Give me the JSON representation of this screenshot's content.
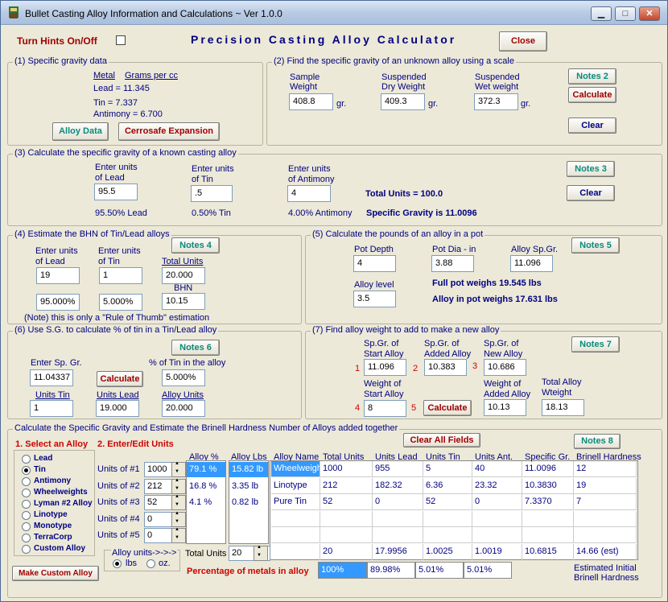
{
  "window": {
    "title": "Bullet Casting Alloy Information and Calculations ~ Ver 1.0.0",
    "minimize": "▁",
    "maximize": "□",
    "close": "✕"
  },
  "top": {
    "hints_label": "Turn Hints On/Off",
    "heading": "Precision Casting Alloy Calculator",
    "close_button": "Close"
  },
  "s1": {
    "title": "(1) Specific gravity data",
    "col_metal": "Metal",
    "col_gpcc": "Grams per cc",
    "lead": "Lead  =  11.345",
    "tin": "Tin  =   7.337",
    "antimony": "Antimony  =  6.700",
    "alloy_data_btn": "Alloy Data",
    "cerrosafe_btn": "Cerrosafe Expansion"
  },
  "s2": {
    "title": "(2) Find the specific gravity of an unknown alloy using a scale",
    "sample_l1": "Sample",
    "sample_l2": "Weight",
    "sample_val": "408.8",
    "dry_l1": "Suspended",
    "dry_l2": "Dry Weight",
    "dry_val": "409.3",
    "wet_l1": "Suspended",
    "wet_l2": "Wet weight",
    "wet_val": "372.3",
    "gr": "gr.",
    "notes_btn": "Notes 2",
    "calc_btn": "Calculate",
    "clear_btn": "Clear"
  },
  "s3": {
    "title": "(3) Calculate the specific gravity of a known casting alloy",
    "lead_l1": "Enter units",
    "lead_l2": "of Lead",
    "lead_val": "95.5",
    "tin_l1": "Enter units",
    "tin_l2": "of Tin",
    "tin_val": ".5",
    "ant_l1": "Enter units",
    "ant_l2": "of Antimony",
    "ant_val": "4",
    "total_units": "Total Units = 100.0",
    "pct_lead": "95.50% Lead",
    "pct_tin": "0.50% Tin",
    "pct_ant": "4.00% Antimony",
    "sg_result": "Specific Gravity is 11.0096",
    "notes_btn": "Notes 3",
    "clear_btn": "Clear"
  },
  "s4": {
    "title": "(4) Estimate the BHN of Tin/Lead alloys",
    "lead_l1": "Enter units",
    "lead_l2": "of Lead",
    "lead_val": "19",
    "tin_l1": "Enter units",
    "tin_l2": "of Tin",
    "tin_val": "1",
    "total_label": "Total Units",
    "total_val": "20.000",
    "bhn_label": "BHN",
    "bhn_val": "10.15",
    "pct_lead": "95.000%",
    "pct_tin": "5.000%",
    "note": "(Note) this is only a \"Rule of Thumb\" estimation",
    "notes_btn": "Notes 4"
  },
  "s5": {
    "title": "(5) Calculate the pounds of an alloy in a pot",
    "depth_label": "Pot Depth",
    "depth_val": "4",
    "dia_label": "Pot Dia - in",
    "dia_val": "3.88",
    "sg_label": "Alloy Sp.Gr.",
    "sg_val": "11.096",
    "level_label": "Alloy level",
    "level_val": "3.5",
    "full_pot": "Full pot weighs 19.545 lbs",
    "in_pot": "Alloy in pot weighs 17.631 lbs",
    "notes_btn": "Notes 5"
  },
  "s6": {
    "title": "(6) Use S.G. to calculate % of tin in a Tin/Lead alloy",
    "sg_label": "Enter Sp. Gr.",
    "sg_val": "11.04337",
    "pct_label": "% of Tin in the alloy",
    "pct_val": "5.000%",
    "units_tin_label": "Units Tin",
    "units_tin_val": "1",
    "units_lead_label": "Units Lead",
    "units_lead_val": "19.000",
    "alloy_units_label": "Alloy Units",
    "alloy_units_val": "20.000",
    "calc_btn": "Calculate",
    "notes_btn": "Notes 6"
  },
  "s7": {
    "title": "(7) Find alloy weight to add  to make a new alloy",
    "start_l1": "Sp.Gr. of",
    "start_l2": "Start Alloy",
    "start_val": "11.096",
    "added_l1": "Sp.Gr. of",
    "added_l2": "Added Alloy",
    "added_val": "10.383",
    "new_l1": "Sp.Gr.  of",
    "new_l2": "New Alloy",
    "new_val": "10.686",
    "wstart_l1": "Weight of",
    "wstart_l2": "Start Alloy",
    "wstart_val": "8",
    "wadded_l1": "Weight of",
    "wadded_l2": "Added Alloy",
    "wadded_val": "10.13",
    "total_l1": "Total Alloy",
    "total_l2": "Wteight",
    "total_val": "18.13",
    "n1": "1",
    "n2": "2",
    "n3": "3",
    "n4": "4",
    "n5": "5",
    "calc_btn": "Calculate",
    "notes_btn": "Notes 7"
  },
  "s8": {
    "title": "Calculate  the Specific Gravity and Estimate the Brinell Hardness Number of Alloys added together",
    "select_label": "1. Select an Alloy",
    "enter_label": "2. Enter/Edit Units",
    "clear_all_btn": "Clear All Fields",
    "notes_btn": "Notes 8",
    "alloys": [
      "Lead",
      "Tin",
      "Antimony",
      "Wheelweights",
      "Lyman #2 Alloy",
      "Linotype",
      "Monotype",
      "TerraCorp",
      "Custom Alloy"
    ],
    "units_labels": [
      "Units of #1",
      "Units of #2",
      "Units of #3",
      "Units of #4",
      "Units of #5"
    ],
    "units_vals": [
      "1000",
      "212",
      "52",
      "0",
      "0"
    ],
    "pct_head": "Alloy %",
    "lbs_head": "Alloy Lbs",
    "pcts": [
      "79.1 %",
      "16.8 %",
      "4.1 %",
      "",
      ""
    ],
    "lbs": [
      "15.82 lb",
      "3.35 lb",
      "0.82 lb",
      "",
      ""
    ],
    "table_headers": [
      "Alloy Name",
      "Total Units",
      "Units Lead",
      "Units Tin",
      "Units Ant.",
      "Specific Gr.",
      "Brinell Hardness"
    ],
    "rows": [
      [
        "Wheelweights",
        "1000",
        "955",
        "5",
        "40",
        "11.0096",
        "12"
      ],
      [
        "Linotype",
        "212",
        "182.32",
        "6.36",
        "23.32",
        "10.3830",
        "19"
      ],
      [
        "Pure Tin",
        "52",
        "0",
        "52",
        "0",
        "7.3370",
        "7"
      ],
      [
        "",
        "",
        "",
        "",
        "",
        "",
        ""
      ],
      [
        "",
        "",
        "",
        "",
        "",
        "",
        ""
      ]
    ],
    "totals": [
      "",
      "20",
      "17.9956",
      "1.0025",
      "1.0019",
      "10.6815",
      "14.66 (est)"
    ],
    "pct_metals_label": "Percentage of metals in alloy",
    "pct_metals": [
      "100%",
      "89.98%",
      "5.01%",
      "5.01%"
    ],
    "alloy_units_label": "Alloy units->->->",
    "lbs_opt": "lbs",
    "oz_opt": "oz.",
    "total_units_label": "Total Units",
    "total_units_val": "20",
    "est_l1": "Estimated Initial",
    "est_l2": "Brinell Hardness",
    "make_custom_btn": "Make Custom Alloy"
  },
  "colors": {
    "navy": "#000080",
    "teal": "#0a8a7a",
    "dark_red": "#a00000",
    "red": "#d00000",
    "highlight": "#3399ff"
  }
}
